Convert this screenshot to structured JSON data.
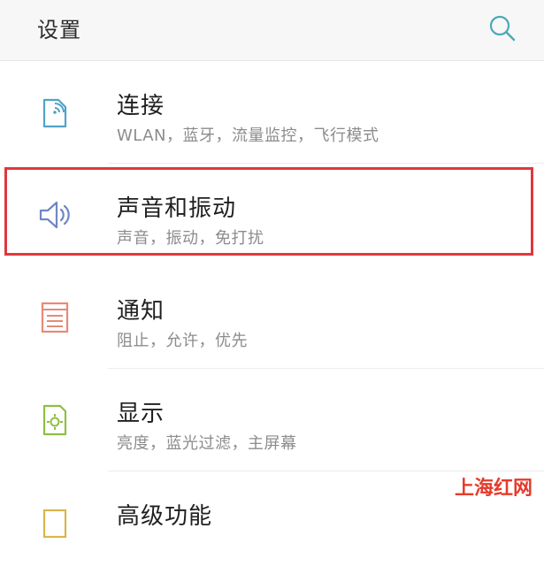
{
  "header": {
    "title": "设置",
    "search_icon": "search-icon"
  },
  "settings": {
    "items": [
      {
        "label": "连接",
        "subtitle": "WLAN，蓝牙，流量监控，飞行模式",
        "icon": "connection-icon",
        "icon_color": "#4fa3c7"
      },
      {
        "label": "声音和振动",
        "subtitle": "声音，振动，免打扰",
        "icon": "volume-icon",
        "icon_color": "#6f86c6",
        "highlighted": true
      },
      {
        "label": "通知",
        "subtitle": "阻止，允许，优先",
        "icon": "notification-icon",
        "icon_color": "#e78a77"
      },
      {
        "label": "显示",
        "subtitle": "亮度，蓝光过滤，主屏幕",
        "icon": "display-icon",
        "icon_color": "#8fbf3f"
      },
      {
        "label": "高级功能",
        "subtitle": "",
        "icon": "advanced-icon",
        "icon_color": "#d9b64a"
      }
    ]
  },
  "colors": {
    "highlight_border": "#e0373d",
    "watermark": "#e53b2c"
  },
  "watermark": "上海红网"
}
